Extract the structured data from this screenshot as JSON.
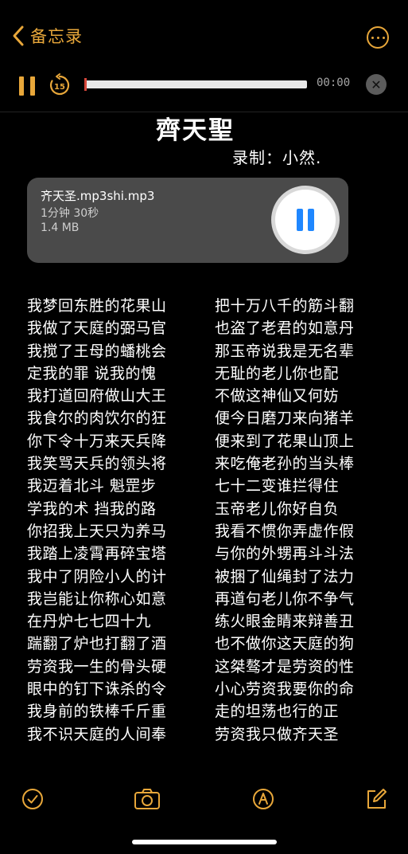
{
  "nav": {
    "back_label": "备忘录",
    "back_icon": "chevron-left-icon",
    "more_icon": "ellipsis-circle-icon",
    "accent_color": "#e8a73a"
  },
  "player": {
    "rewind_label": "15",
    "time": "00:00",
    "progress": 0
  },
  "note": {
    "title": "齊天聖",
    "subtitle": "录制：小然."
  },
  "attachment": {
    "name": "齐天圣.mp3shi.mp3",
    "duration": "1分钟 30秒",
    "size": "1.4 MB"
  },
  "lyrics": {
    "left": [
      "我梦回东胜的花果山",
      "我做了天庭的弼马官",
      "我搅了王母的蟠桃会",
      "定我的罪    说我的愧",
      "我打道回府做山大王",
      "我食尔的肉饮尔的狂",
      "你下令十万来天兵降",
      "我笑骂天兵的领头将",
      "我迈着北斗 魁罡步",
      "学我的术 挡我的路",
      "你招我上天只为养马",
      "我踏上凌霄再碎宝塔",
      "我中了阴险小人的计",
      "我岂能让你称心如意",
      "在丹炉七七四十九",
      "踹翻了炉也打翻了酒",
      "劳资我一生的骨头硬",
      "眼中的钉下诛杀的令",
      "我身前的铁棒千斤重",
      "我不识天庭的人间奉"
    ],
    "right": [
      "把十万八千的筋斗翻",
      "也盗了老君的如意丹",
      "那玉帝说我是无名辈",
      "无耻的老儿你也配",
      "不做这神仙又何妨",
      "便今日磨刀来向猪羊",
      "便来到了花果山顶上",
      "来吃俺老孙的当头棒",
      "七十二变谁拦得住",
      "玉帝老儿你好自负",
      "我看不惯你弄虚作假",
      "与你的外甥再斗斗法",
      "被捆了仙绳封了法力",
      "再道句老儿你不争气",
      "练火眼金睛来辩善丑",
      "也不做你这天庭的狗",
      "这桀骜才是劳资的性",
      "小心劳资我要你的命",
      "走的坦荡也行的正",
      "劳资我只做齐天圣"
    ]
  },
  "toolbar": {
    "items": [
      "checklist-icon",
      "camera-icon",
      "markup-pen-icon",
      "compose-icon"
    ]
  }
}
